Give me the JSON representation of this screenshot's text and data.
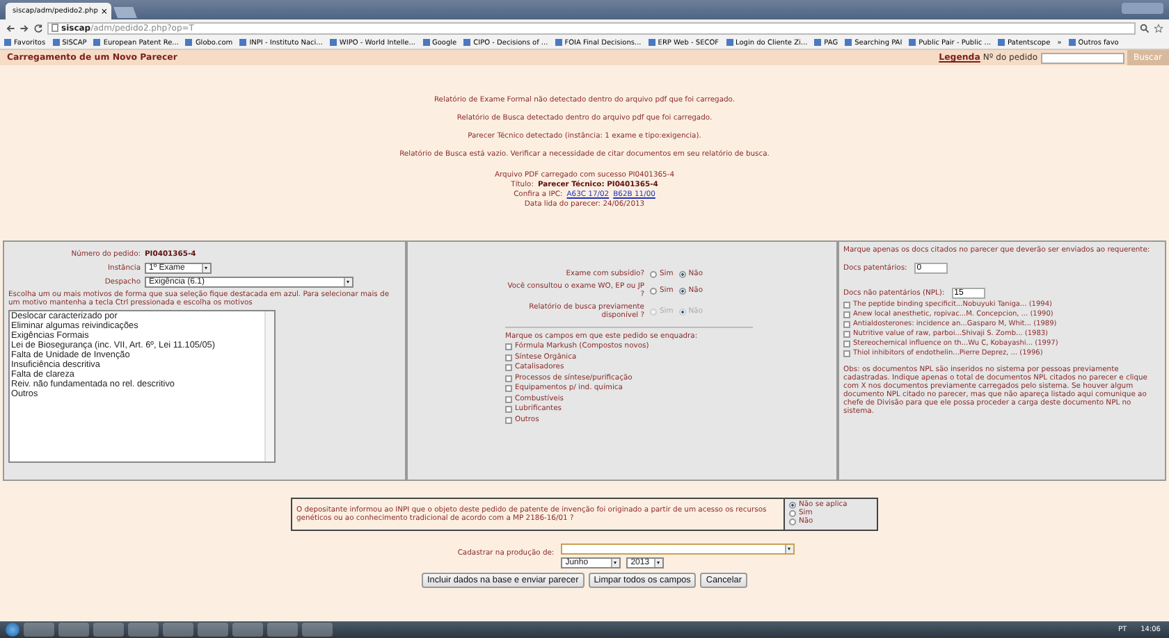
{
  "browser": {
    "tab_title": "siscap/adm/pedido2.php",
    "tab_close": "×",
    "url_host": "siscap",
    "url_path": "/adm/pedido2.php?op=T",
    "bookmarks": [
      "Favoritos",
      "SISCAP",
      "European Patent Re...",
      "Globo.com",
      "INPI - Instituto Naci...",
      "WIPO - World Intelle...",
      "Google",
      "CIPO - Decisions of ...",
      "FOIA Final Decisions...",
      "ERP Web - SECOF",
      "Login do Cliente Zi...",
      "PAG",
      "Searching PAI",
      "Public Pair - Public ...",
      "Patentscope",
      "»",
      "Outros favo"
    ]
  },
  "header": {
    "title": "Carregamento de um Novo Parecer",
    "legend_link": "Legenda",
    "search_label": "Nº do pedido",
    "search_button": "Buscar"
  },
  "messages": [
    "Relatório de Exame Formal não detectado dentro do arquivo pdf que foi carregado.",
    "Relatório de Busca detectado dentro do arquivo pdf que foi carregado.",
    "Parecer Técnico detectado (instância: 1 exame e tipo:exigencia).",
    "Relatório de Busca está vazio. Verificar a necessidade de citar documentos em seu relatório de busca."
  ],
  "upload": {
    "line": "Arquivo PDF carregado com sucesso PI0401365-4",
    "title_label": "Título:",
    "title_value": "Parecer Técnico: PI0401365-4",
    "ipc_label": "Confira a IPC:",
    "ipc_links": [
      "A63C 17/02",
      "B62B 11/00"
    ],
    "date_line": "Data lida do parecer: 24/06/2013"
  },
  "left": {
    "number_label": "Número do pedido:",
    "number_value": "PI0401365-4",
    "instancia_label": "Instância",
    "instancia_value": "1º Exame",
    "despacho_label": "Despacho",
    "despacho_value": "Exigência (6.1)",
    "instructions": "Escolha um ou mais motivos de forma que sua seleção fique destacada em azul. Para selecionar mais de um motivo mantenha a tecla Ctrl pressionada e escolha os motivos",
    "motivos": [
      {
        "label": "Deslocar caracterizado por",
        "selected": false
      },
      {
        "label": "Eliminar algumas reivindicações",
        "selected": false
      },
      {
        "label": "Exigências Formais",
        "selected": false
      },
      {
        "label": "Lei de Biosegurança (inc. VII, Art. 6º, Lei 11.105/05)",
        "selected": false
      },
      {
        "label": "Falta de Unidade de Invenção",
        "selected": false
      },
      {
        "label": "Insuficiência descritiva",
        "selected": false
      },
      {
        "label": "Falta de clareza",
        "selected": false
      },
      {
        "label": "Reiv. não fundamentada no rel. descritivo",
        "selected": false
      },
      {
        "label": "Outros",
        "selected": false
      }
    ]
  },
  "middle": {
    "questions": [
      {
        "label": "Exame com subsídio?",
        "disabled": false,
        "options": [
          {
            "label": "Sim",
            "selected": false
          },
          {
            "label": "Não",
            "selected": true
          }
        ]
      },
      {
        "label": "Você consultou o exame WO, EP ou JP ?",
        "disabled": false,
        "options": [
          {
            "label": "Sim",
            "selected": false
          },
          {
            "label": "Não",
            "selected": true
          }
        ]
      },
      {
        "label": "Relatório de busca previamente disponível ?",
        "disabled": true,
        "options": [
          {
            "label": "Sim",
            "selected": false
          },
          {
            "label": "Não",
            "selected": true
          }
        ]
      }
    ],
    "fields_label": "Marque os campos em que este pedido se enquadra:",
    "fields": [
      {
        "label": "Fórmula Markush (Compostos novos)",
        "checked": false
      },
      {
        "label": "Síntese Orgânica",
        "checked": false
      },
      {
        "label": "Catalisadores",
        "checked": false
      },
      {
        "label": "Processos de síntese/purificação",
        "checked": false
      },
      {
        "label": "Equipamentos p/ ind. química",
        "checked": false
      },
      {
        "label": "Combustíveis",
        "checked": false
      },
      {
        "label": "Lubrificantes",
        "checked": false
      },
      {
        "label": "Outros",
        "checked": false
      }
    ]
  },
  "right": {
    "intro": "Marque apenas os docs citados no parecer que deverão ser enviados ao requerente:",
    "patent_label": "Docs patentários:",
    "patent_value": "0",
    "npl_label": "Docs não patentários (NPL):",
    "npl_value": "15",
    "docs": [
      {
        "label": "The peptide binding specificit...Nobuyuki Taniga... (1994)",
        "checked": false
      },
      {
        "label": "Anew local anesthetic, ropivac...M. Concepcion, ... (1990)",
        "checked": false
      },
      {
        "label": "Antialdosterones: incidence an...Gasparo M, Whit... (1989)",
        "checked": false
      },
      {
        "label": "Nutritive value of raw, parboi...Shivaji S. Zomb... (1983)",
        "checked": false
      },
      {
        "label": "Stereochemical influence on th...Wu C, Kobayashi... (1997)",
        "checked": false
      },
      {
        "label": "Thiol inhibitors of endothelin...Pierre Deprez, ... (1996)",
        "checked": false
      }
    ],
    "note": "Obs: os documentos NPL são inseridos no sistema por pessoas previamente cadastradas. Indique apenas o total de documentos NPL citados no parecer e clique com X nos documentos previamente carregados pelo sistema. Se houver algum documento NPL citado no parecer, mas que não apareça listado aqui comunique ao chefe de Divisão para que ele possa proceder a carga deste documento NPL no sistema."
  },
  "genetic": {
    "question": "O depositante informou ao INPI que o objeto deste pedido de patente de invenção foi originado a partir de um acesso os recursos genéticos ou ao conhecimento tradicional de acordo com a MP 2186-16/01 ?",
    "options": [
      {
        "label": "Não se aplica",
        "selected": true
      },
      {
        "label": "Sim",
        "selected": false
      },
      {
        "label": "Não",
        "selected": false
      }
    ]
  },
  "production": {
    "label": "Cadastrar na produção de:",
    "month": "Junho",
    "year": "2013"
  },
  "buttons": [
    "Incluir dados na base e enviar parecer",
    "Limpar todos os campos",
    "Cancelar"
  ],
  "taskbar": {
    "language": "PT",
    "time": "14:06"
  }
}
